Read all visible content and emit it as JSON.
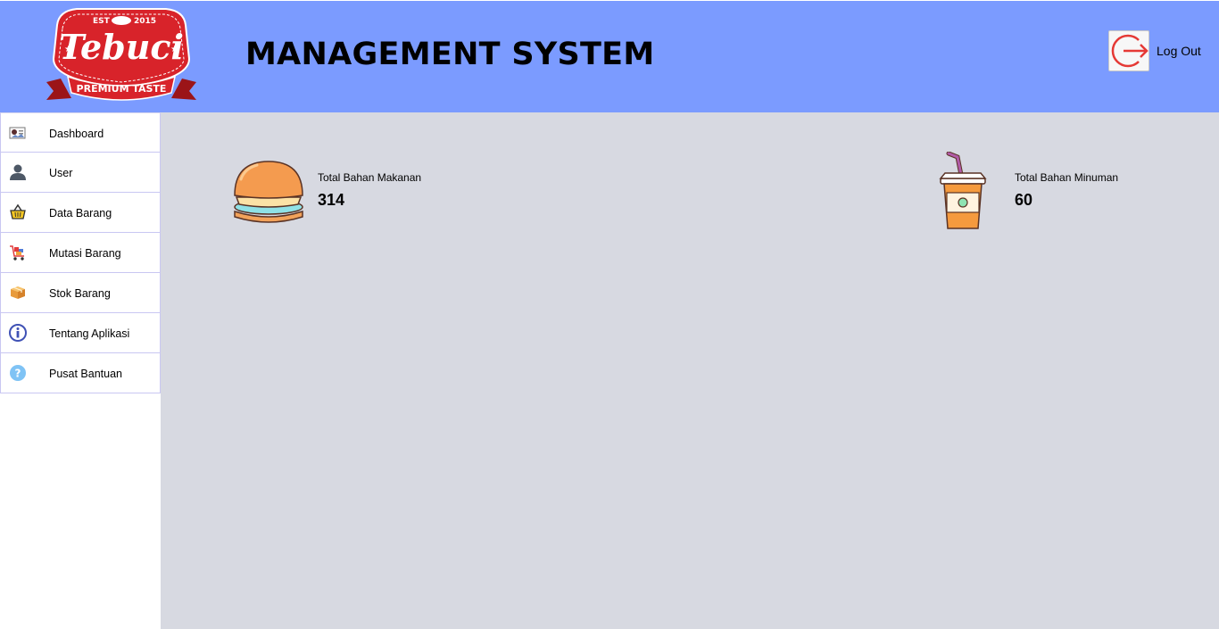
{
  "header": {
    "title": "MANAGEMENT SYSTEM",
    "logout_label": "Log Out",
    "logo": {
      "brand": "Tebuci",
      "tagline": "PREMIUM TASTE",
      "est_left": "EST",
      "est_right": "2015"
    }
  },
  "sidebar": {
    "items": [
      {
        "label": "Dashboard",
        "icon": "dashboard-icon"
      },
      {
        "label": "User",
        "icon": "user-icon"
      },
      {
        "label": "Data Barang",
        "icon": "basket-icon"
      },
      {
        "label": "Mutasi Barang",
        "icon": "cart-icon"
      },
      {
        "label": "Stok Barang",
        "icon": "box-icon"
      },
      {
        "label": "Tentang Aplikasi",
        "icon": "info-icon"
      },
      {
        "label": "Pusat Bantuan",
        "icon": "help-icon"
      }
    ]
  },
  "stats": {
    "food": {
      "label": "Total Bahan Makanan",
      "value": "314",
      "icon": "burger-icon"
    },
    "drink": {
      "label": "Total Bahan Minuman",
      "value": "60",
      "icon": "drink-cup-icon"
    }
  },
  "colors": {
    "header_bg": "#7b9bff",
    "content_bg": "#d7d9e1",
    "logo_red": "#d8232a",
    "logout_red": "#e53935"
  }
}
